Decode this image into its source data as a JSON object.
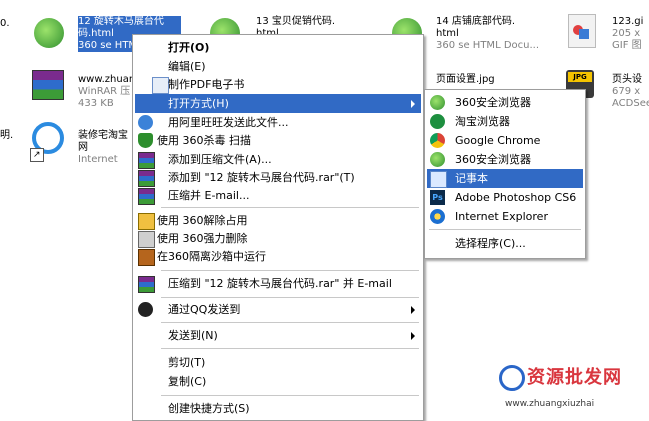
{
  "desktop": {
    "left_fragments": {
      "top": "0.",
      "middle": "明."
    },
    "files": [
      {
        "line1": "12 旋转木马展台代",
        "line2": "码.html",
        "line3": "360 se HTML Docu..."
      },
      {
        "line1": "13 宝贝促销代码.",
        "line2": "html",
        "line3": ""
      },
      {
        "line1": "14 店铺底部代码.",
        "line2": "html",
        "line3": "360 se HTML Docu..."
      },
      {
        "line1": "123.gi",
        "line2": "205 x",
        "line3": "GIF 图"
      },
      {
        "line1": "www.zhuan",
        "line2": "WinRAR 压",
        "line3": "433 KB"
      },
      {
        "line1": "页面设置.jpg",
        "line2": "",
        "line3": ""
      },
      {
        "line1": "页头设",
        "line2": "679 x",
        "line3": "ACDSee"
      },
      {
        "line1": "装修宅淘宝",
        "line2": "网",
        "line3": "Internet"
      }
    ]
  },
  "context_menu": {
    "items": [
      {
        "label": "打开(O)",
        "icon": "",
        "bold": true
      },
      {
        "label": "编辑(E)",
        "icon": ""
      },
      {
        "label": "制作PDF电子书",
        "icon": "pdf-icon"
      },
      {
        "label": "打开方式(H)",
        "icon": "",
        "submenu": true,
        "highlight": true
      },
      {
        "label": "用阿里旺旺发送此文件...",
        "icon": "aliwangwang-icon"
      },
      {
        "label": "使用 360杀毒 扫描",
        "icon": "360-antivirus-icon"
      },
      {
        "label": "添加到压缩文件(A)...",
        "icon": "winrar-icon"
      },
      {
        "label": "添加到 \"12 旋转木马展台代码.rar\"(T)",
        "icon": "winrar-icon"
      },
      {
        "label": "压缩并 E-mail...",
        "icon": "winrar-icon"
      },
      {
        "label": "使用 360解除占用",
        "icon": "360-unlock-icon"
      },
      {
        "label": "使用 360强力删除",
        "icon": "360-delete-icon"
      },
      {
        "label": "在360隔离沙箱中运行",
        "icon": "360-sandbox-icon"
      },
      {
        "label": "压缩到 \"12 旋转木马展台代码.rar\" 并 E-mail",
        "icon": "winrar-icon"
      },
      {
        "label": "通过QQ发送到",
        "icon": "qq-icon",
        "submenu": true
      },
      {
        "label": "发送到(N)",
        "icon": "",
        "submenu": true
      },
      {
        "label": "剪切(T)",
        "icon": ""
      },
      {
        "label": "复制(C)",
        "icon": ""
      },
      {
        "label": "创建快捷方式(S)",
        "icon": ""
      }
    ]
  },
  "open_with_submenu": {
    "items": [
      {
        "label": "360安全浏览器",
        "icon": "360-browser-icon"
      },
      {
        "label": "淘宝浏览器",
        "icon": "taobao-browser-icon"
      },
      {
        "label": "Google Chrome",
        "icon": "chrome-icon"
      },
      {
        "label": "360安全浏览器",
        "icon": "360-browser-icon"
      },
      {
        "label": "记事本",
        "icon": "notepad-icon",
        "highlight": true
      },
      {
        "label": "Adobe Photoshop CS6",
        "icon": "photoshop-icon"
      },
      {
        "label": "Internet Explorer",
        "icon": "ie-icon"
      },
      {
        "label": "选择程序(C)...",
        "icon": ""
      }
    ]
  },
  "watermark": {
    "line1": "资源批发网",
    "line2": "www.zhuangxiuzhai"
  },
  "colors": {
    "highlight": "#316ac5",
    "selection_text_bg": "#316ac5",
    "menu_border": "#9d9d9d"
  }
}
